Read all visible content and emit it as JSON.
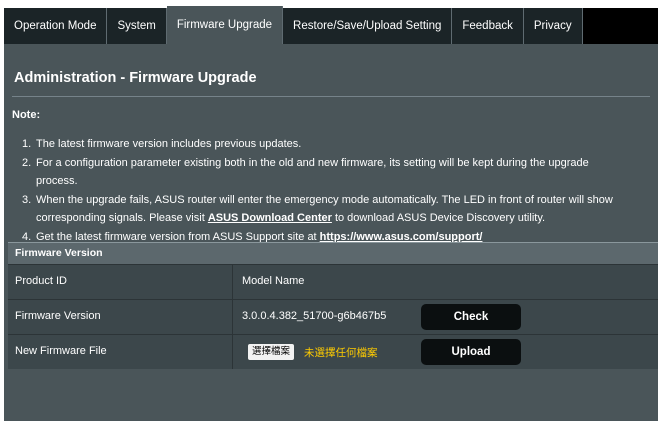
{
  "tabs": [
    {
      "label": "Operation Mode",
      "active": false
    },
    {
      "label": "System",
      "active": false
    },
    {
      "label": "Firmware Upgrade",
      "active": true
    },
    {
      "label": "Restore/Save/Upload Setting",
      "active": false
    },
    {
      "label": "Feedback",
      "active": false
    },
    {
      "label": "Privacy",
      "active": false
    }
  ],
  "page": {
    "title": "Administration - Firmware Upgrade",
    "note_label": "Note:"
  },
  "notes": {
    "n1": {
      "num": "1.",
      "text": "The latest firmware version includes previous updates."
    },
    "n2": {
      "num": "2.",
      "text": "For a configuration parameter existing both in the old and new firmware, its setting will be kept during the upgrade",
      "text2": "process."
    },
    "n3": {
      "num": "3.",
      "text_a": "When the upgrade fails, ASUS router will enter the emergency mode automatically. The LED in front of router will show",
      "text_b": "corresponding signals. Please visit ",
      "link": "ASUS Download Center",
      "text_c": " to download ASUS Device Discovery utility."
    },
    "n4": {
      "num": "4.",
      "text": "Get the latest firmware version from ASUS Support site at ",
      "link": "https://www.asus.com/support/"
    }
  },
  "table": {
    "header": "Firmware Version",
    "rows": {
      "product_id": {
        "label": "Product ID",
        "value": "Model Name"
      },
      "firmware_version": {
        "label": "Firmware Version",
        "value": "3.0.0.4.382_51700-g6b467b5",
        "button": "Check"
      },
      "new_firmware": {
        "label": "New Firmware File",
        "choose_button": "選擇檔案",
        "file_status": "未選擇任何檔案",
        "button": "Upload"
      }
    }
  },
  "colors": {
    "panel_bg": "#4a5559",
    "tab_bg": "#1b2427",
    "button_bg": "#0b0f10",
    "file_status": "#ffcc00"
  }
}
